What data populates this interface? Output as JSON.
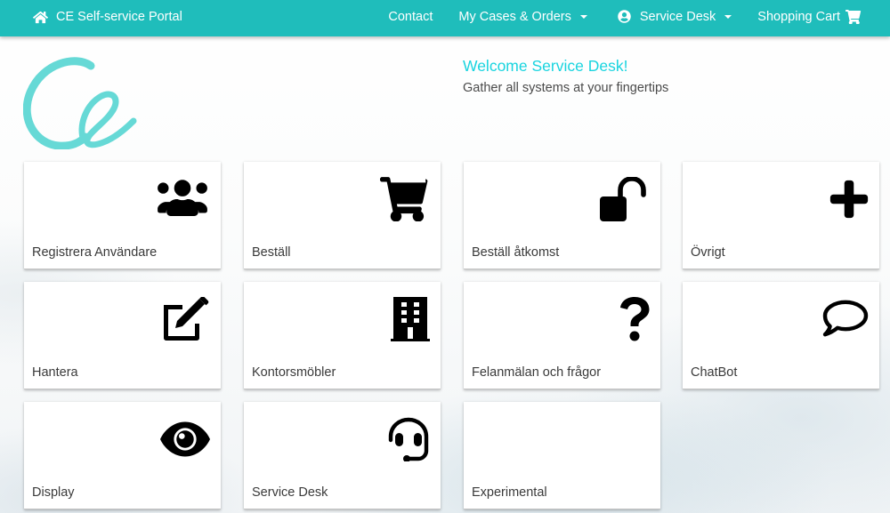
{
  "navbar": {
    "brand": {
      "icon": "home-icon",
      "label": "CE Self-service Portal"
    },
    "links": [
      {
        "label": "Contact",
        "has_dropdown": false
      },
      {
        "label": "My Cases & Orders",
        "has_dropdown": true
      },
      {
        "label": "Service Desk",
        "icon": "user-circle-icon",
        "has_dropdown": true
      },
      {
        "label": "Shopping Cart",
        "icon": "shopping-cart-icon",
        "has_dropdown": false
      }
    ]
  },
  "logo": {
    "text": "Ce",
    "color": "#66d9d6"
  },
  "welcome": {
    "title": "Welcome Service Desk!",
    "subtitle": "Gather all systems at your fingertips"
  },
  "colors": {
    "navbar": "#1fbdbb",
    "welcome_title": "#19d4df"
  },
  "tiles": [
    {
      "label": "Registrera Användare",
      "icon": "users-icon"
    },
    {
      "label": "Beställ",
      "icon": "shopping-cart-icon"
    },
    {
      "label": "Beställ åtkomst",
      "icon": "unlock-icon"
    },
    {
      "label": "Övrigt",
      "icon": "plus-icon"
    },
    {
      "label": "Hantera",
      "icon": "edit-icon"
    },
    {
      "label": "Kontorsmöbler",
      "icon": "building-icon"
    },
    {
      "label": "Felanmälan och frågor",
      "icon": "question-icon"
    },
    {
      "label": "ChatBot",
      "icon": "comment-icon"
    },
    {
      "label": "Display",
      "icon": "eye-icon"
    },
    {
      "label": "Service Desk",
      "icon": "headset-icon"
    },
    {
      "label": "Experimental",
      "icon": ""
    }
  ]
}
